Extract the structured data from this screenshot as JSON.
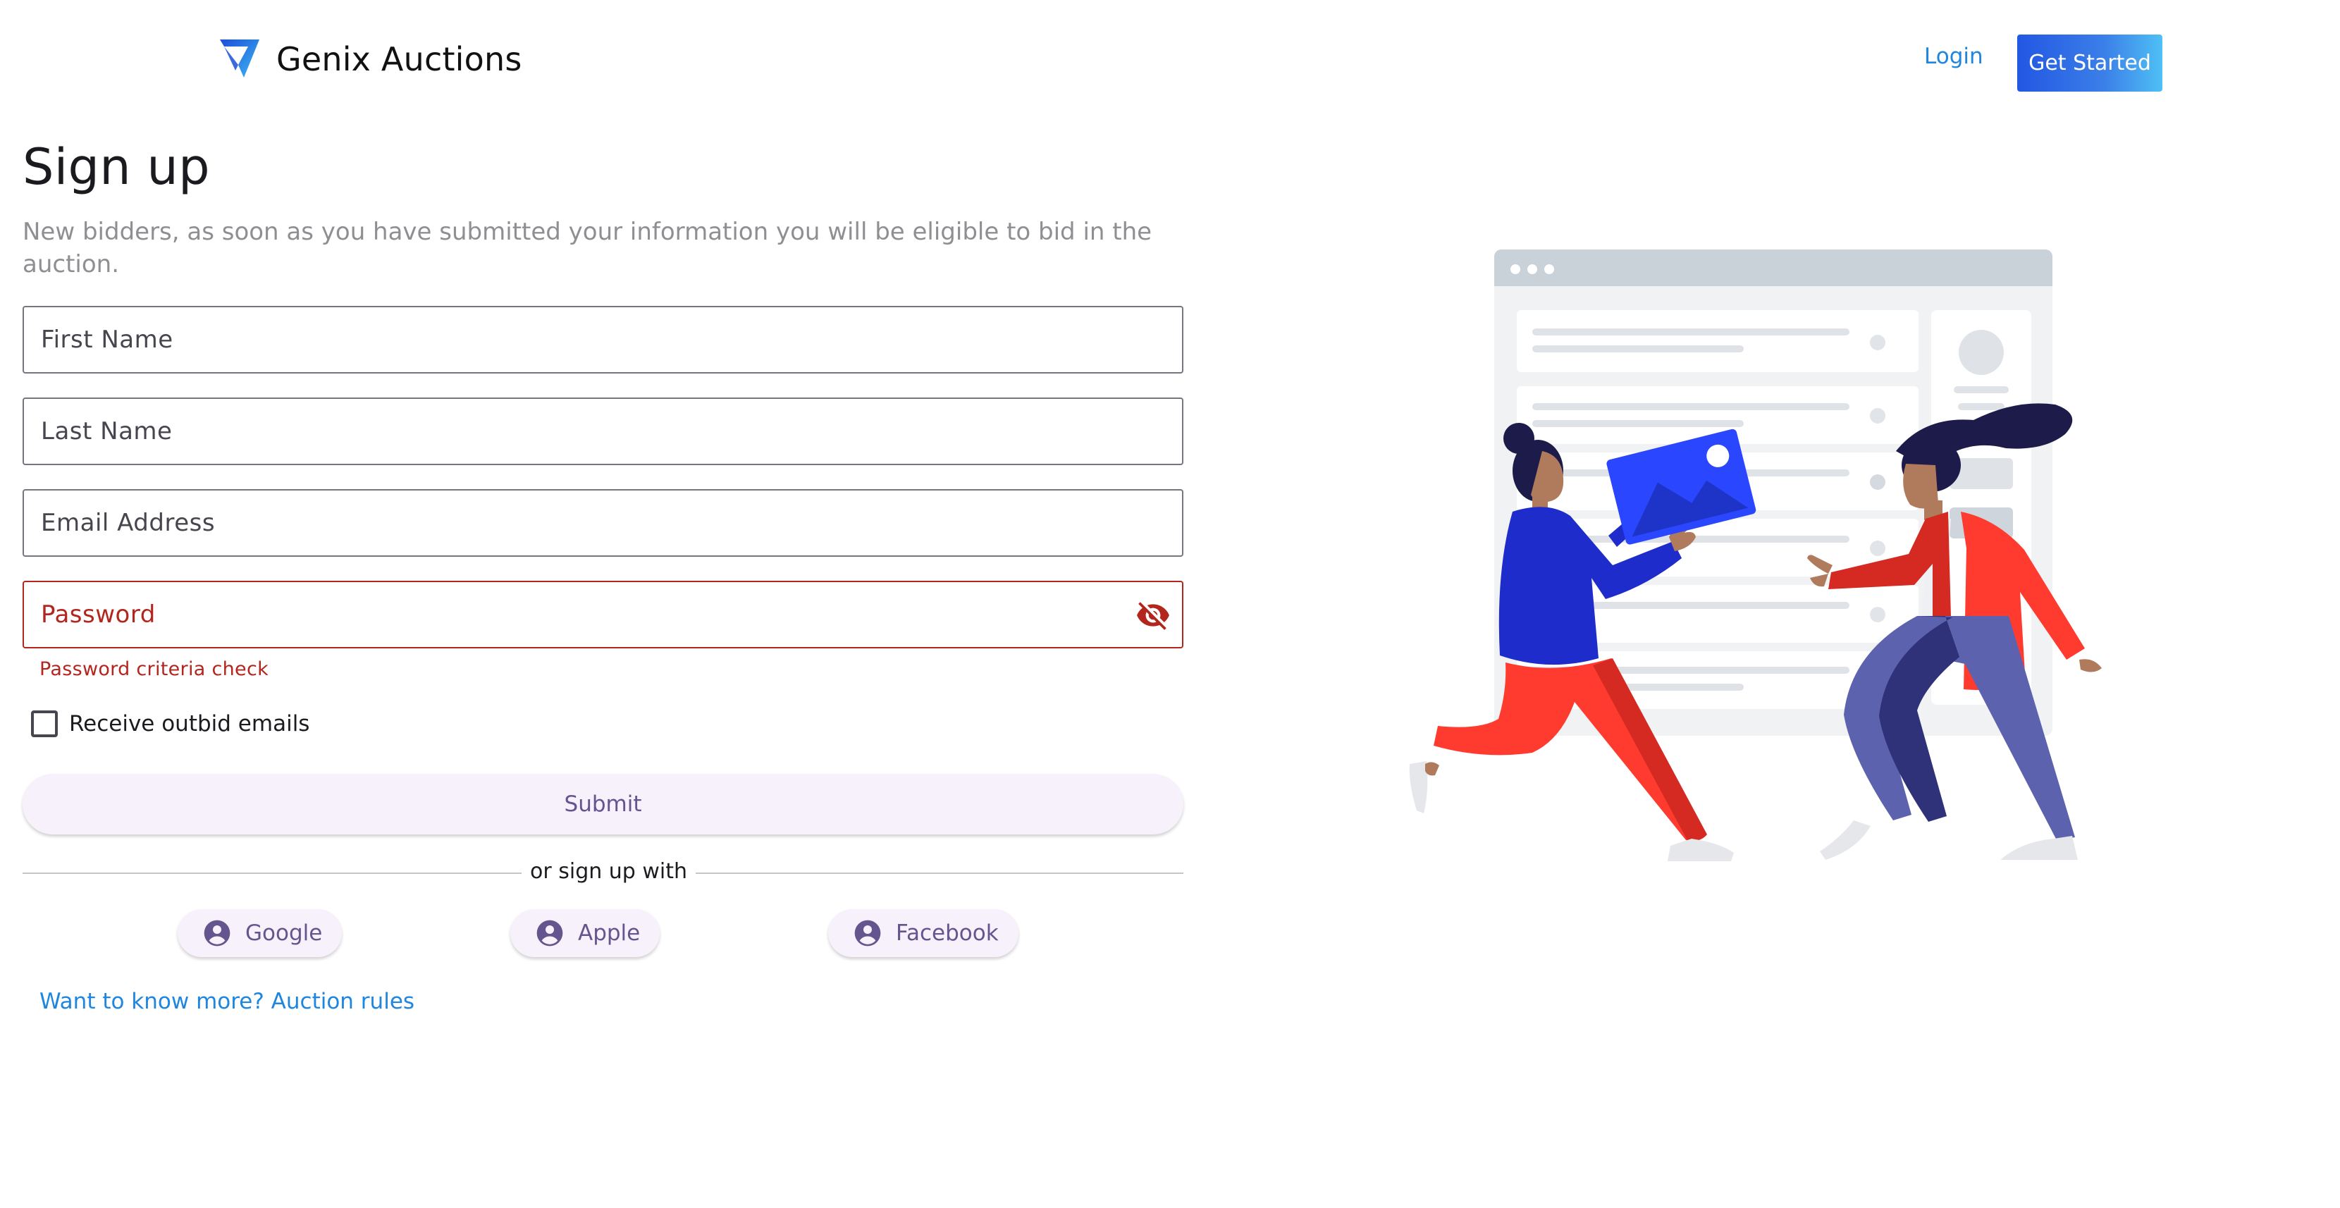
{
  "header": {
    "brand_name": "Genix Auctions",
    "login_label": "Login",
    "cta_label": "Get Started",
    "logo_icon": "genix-chevron-logo"
  },
  "signup": {
    "title": "Sign up",
    "intro": "New bidders, as soon as you have submitted your information you will be eligible to bid in the auction.",
    "fields": {
      "first_name": {
        "placeholder": "First Name",
        "value": ""
      },
      "last_name": {
        "placeholder": "Last Name",
        "value": ""
      },
      "email": {
        "placeholder": "Email Address",
        "value": ""
      },
      "password": {
        "placeholder": "Password",
        "value": "",
        "error": "Password criteria check",
        "toggle_icon": "eye-off-icon"
      }
    },
    "outbid_checkbox": {
      "label": "Receive outbid emails",
      "checked": false
    },
    "submit_label": "Submit",
    "divider_label": "or sign up with",
    "social": [
      {
        "label": "Google",
        "icon": "account-circle-icon"
      },
      {
        "label": "Apple",
        "icon": "account-circle-icon"
      },
      {
        "label": "Facebook",
        "icon": "account-circle-icon"
      }
    ],
    "rules_link": "Want to know more? Auction rules"
  },
  "colors": {
    "link": "#1f86e0",
    "error": "#b3261e",
    "button_tint": "#65558f",
    "cta_start": "#2257e3",
    "cta_end": "#4fc0f5"
  }
}
